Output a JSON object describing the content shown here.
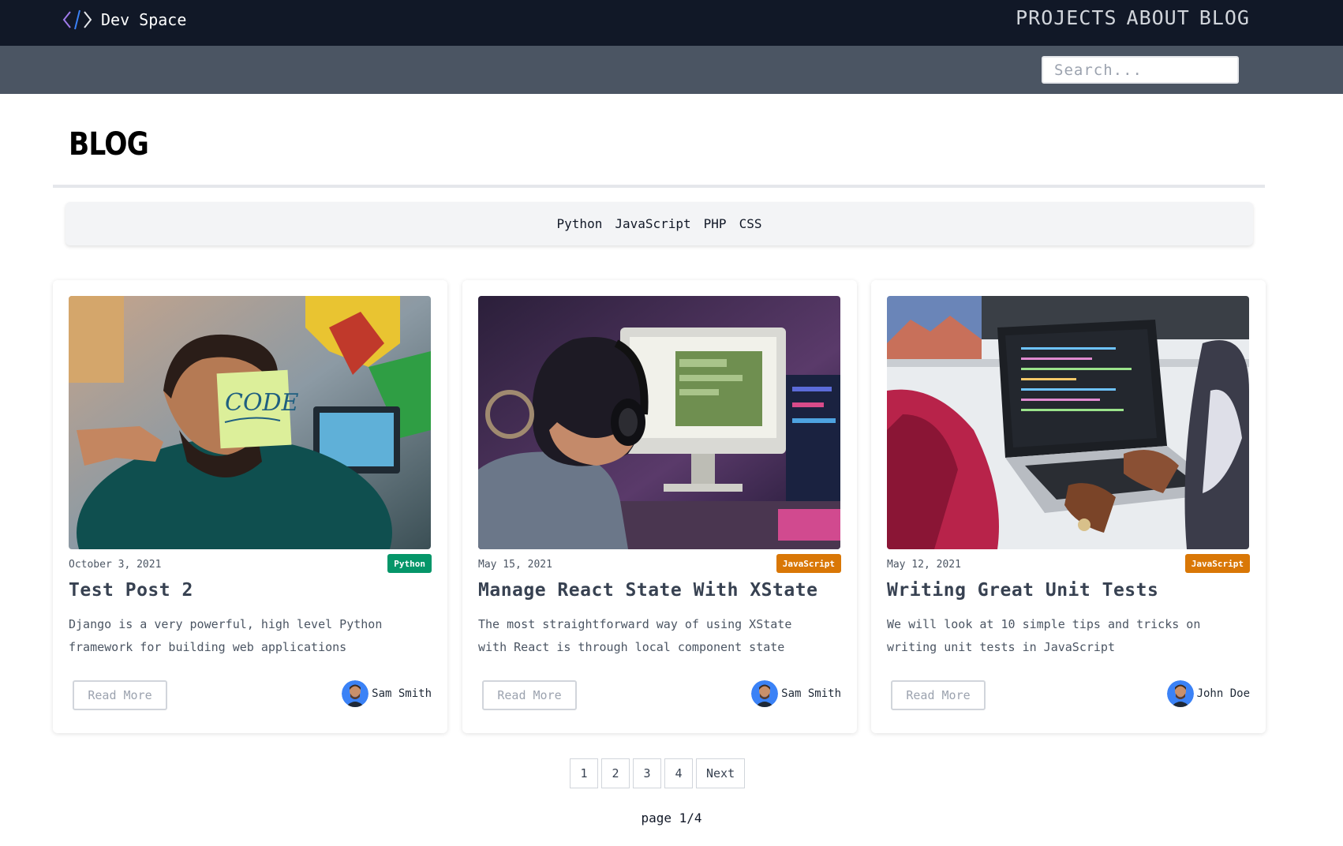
{
  "header": {
    "brand": "Dev Space",
    "nav": [
      "PROJECTS",
      "ABOUT",
      "BLOG"
    ]
  },
  "search": {
    "placeholder": "Search..."
  },
  "page": {
    "title": "BLOG"
  },
  "categories": [
    "Python",
    "JavaScript",
    "PHP",
    "CSS"
  ],
  "posts": [
    {
      "date": "October 3, 2021",
      "category": "Python",
      "category_color": "#059669",
      "title": "Test Post 2",
      "excerpt": "Django is a very powerful, high level Python framework for building web applications",
      "read_more": "Read More",
      "author": "Sam Smith",
      "image_icon": "man-holding-code-note-photo"
    },
    {
      "date": "May 15, 2021",
      "category": "JavaScript",
      "category_color": "#d97706",
      "title": "Manage React State With XState",
      "excerpt": "The most straightforward way of using XState with React is through local component state",
      "read_more": "Read More",
      "author": "Sam Smith",
      "image_icon": "developer-with-headphones-photo"
    },
    {
      "date": "May 12, 2021",
      "category": "JavaScript",
      "category_color": "#d97706",
      "title": "Writing Great Unit Tests",
      "excerpt": "We will look at 10 simple tips and tricks on writing unit tests in JavaScript",
      "read_more": "Read More",
      "author": "John Doe",
      "image_icon": "laptop-with-code-photo"
    }
  ],
  "pagination": {
    "pages": [
      "1",
      "2",
      "3",
      "4"
    ],
    "next": "Next",
    "status": "page 1/4"
  },
  "colors": {
    "topbar": "#111827",
    "searchbar": "#4b5563"
  }
}
